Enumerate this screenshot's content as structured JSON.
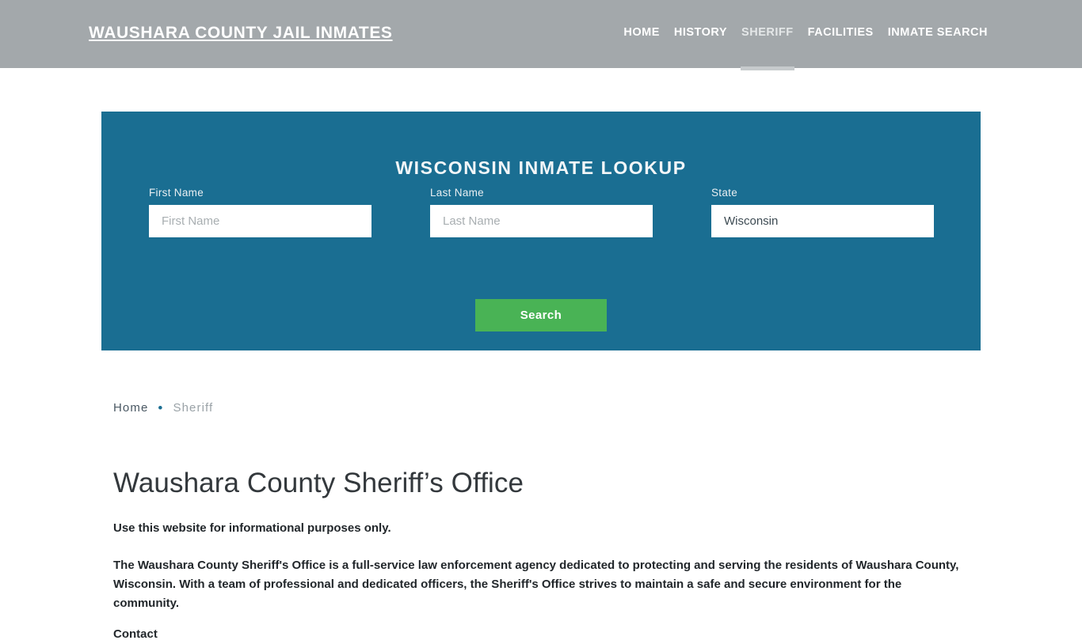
{
  "header": {
    "brand": "Waushara County Jail Inmates",
    "brand_color": "#ffffff",
    "background_color": "#a3a8ab",
    "nav": [
      {
        "label": "Home",
        "active": false
      },
      {
        "label": "History",
        "active": false
      },
      {
        "label": "Sheriff",
        "active": true
      },
      {
        "label": "Facilities",
        "active": false
      },
      {
        "label": "Inmate Search",
        "active": false
      }
    ]
  },
  "lookup": {
    "title": "Wisconsin Inmate Lookup",
    "panel_color": "#1a6e92",
    "fields": [
      {
        "label": "First Name",
        "placeholder": "First Name",
        "value": ""
      },
      {
        "label": "Last Name",
        "placeholder": "Last Name",
        "value": ""
      },
      {
        "label": "State",
        "placeholder": "State",
        "value": "Wisconsin"
      }
    ],
    "submit_label": "Search",
    "submit_color": "#49b355"
  },
  "breadcrumb": {
    "home_label": "Home",
    "separator": "•",
    "current_label": "Sheriff",
    "separator_color": "#1a6e92"
  },
  "main": {
    "title": "Waushara County Sheriff’s Office",
    "lede": "Use this website for informational purposes only.",
    "paragraph": "The Waushara County Sheriff's Office is a full-service law enforcement agency dedicated to protecting and serving the residents of Waushara County, Wisconsin. With a team of professional and dedicated officers, the Sheriff's Office strives to maintain a safe and secure environment for the community.",
    "paragraph_clipped": "Contact"
  }
}
